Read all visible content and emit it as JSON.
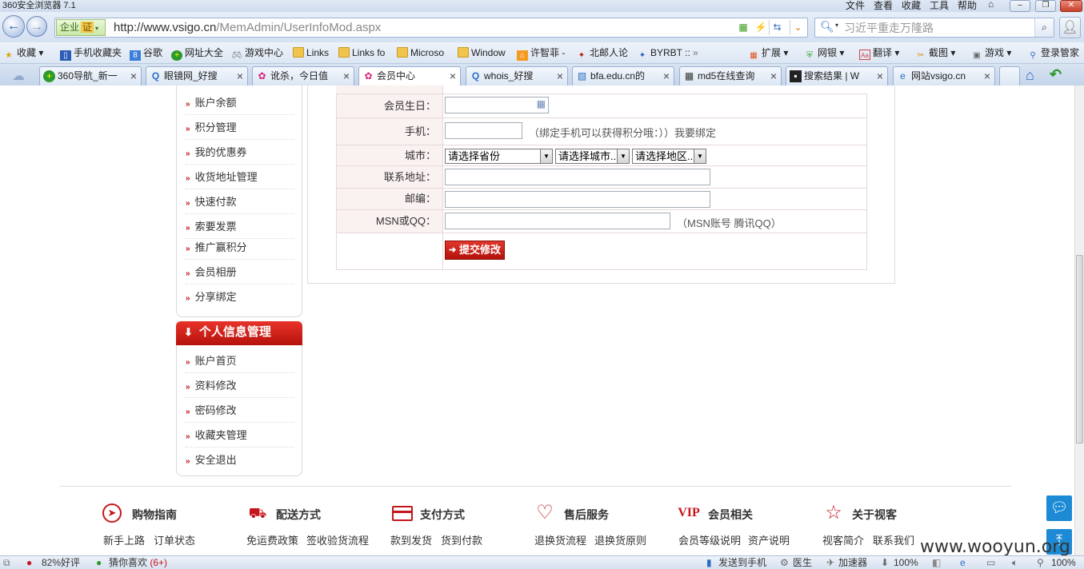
{
  "browser": {
    "title": "360安全浏览器 7.1",
    "menu": [
      "文件",
      "查看",
      "收藏",
      "工具",
      "帮助"
    ],
    "enterprise_label": "企业",
    "cert_label": "证",
    "url_host": "http://www.vsigo.cn",
    "url_path": "/MemAdmin/UserInfoMod.aspx",
    "search_placeholder": "习近平重走万隆路"
  },
  "bookmarks": [
    {
      "label": "收藏",
      "icon": "star-icon"
    },
    {
      "label": "手机收藏夹",
      "icon": "phone-icon"
    },
    {
      "label": "谷歌",
      "icon": "google-icon"
    },
    {
      "label": "网址大全",
      "icon": "360-icon"
    },
    {
      "label": "游戏中心",
      "icon": "gamepad-icon"
    },
    {
      "label": "Links",
      "icon": "folder-icon"
    },
    {
      "label": "Links fo",
      "icon": "folder-icon"
    },
    {
      "label": "Microso",
      "icon": "folder-icon"
    },
    {
      "label": "Window",
      "icon": "folder-icon"
    },
    {
      "label": "许智菲 -",
      "icon": "site-icon"
    },
    {
      "label": "北邮人论",
      "icon": "byr-icon"
    },
    {
      "label": "BYRBT ::",
      "icon": "byr-icon"
    },
    {
      "label": "»",
      "icon": ""
    }
  ],
  "toolbar_right": [
    {
      "label": "扩展",
      "icon": "grid-icon"
    },
    {
      "label": "网银",
      "icon": "shield-icon"
    },
    {
      "label": "翻译",
      "icon": "translate-icon"
    },
    {
      "label": "截图",
      "icon": "scissors-icon"
    },
    {
      "label": "游戏",
      "icon": "game-icon"
    },
    {
      "label": "登录管家",
      "icon": "login-icon"
    }
  ],
  "tabs": [
    {
      "label": "360导航_新一",
      "active": false
    },
    {
      "label": "眼镜网_好搜",
      "active": false
    },
    {
      "label": "讹杀，今日值",
      "active": false
    },
    {
      "label": "会员中心",
      "active": true
    },
    {
      "label": "whois_好搜",
      "active": false
    },
    {
      "label": "bfa.edu.cn的",
      "active": false
    },
    {
      "label": "md5在线查询",
      "active": false
    },
    {
      "label": "搜索结果 | W",
      "active": false
    },
    {
      "label": "网站vsigo.cn",
      "active": false
    }
  ],
  "sidebar": {
    "top_items": [
      "账户余额",
      "积分管理",
      "我的优惠券",
      "收货地址管理",
      "快速付款",
      "索要发票",
      "推广赢积分",
      "会员相册",
      "分享绑定"
    ],
    "section_title": "个人信息管理",
    "section_items": [
      "账户首页",
      "资料修改",
      "密码修改",
      "收藏夹管理",
      "安全退出"
    ]
  },
  "form": {
    "birthday_label": "会员生日：",
    "phone_label": "手机：",
    "phone_hint": "（绑定手机可以获得积分哦：））我要绑定",
    "city_label": "城市：",
    "province_select": "请选择省份",
    "city_select": "请选择城市..",
    "district_select": "请选择地区..",
    "address_label": "联系地址：",
    "zip_label": "邮编：",
    "msn_label": "MSN或QQ：",
    "msn_hint": "（MSN账号 腾讯QQ）",
    "submit_label": "提交修改"
  },
  "footer": {
    "columns": [
      {
        "title": "购物指南",
        "icon": "compass-icon",
        "links": [
          "新手上路",
          "订单状态"
        ]
      },
      {
        "title": "配送方式",
        "icon": "truck-icon",
        "links": [
          "免运费政策",
          "签收验货流程"
        ]
      },
      {
        "title": "支付方式",
        "icon": "card-icon",
        "links": [
          "款到发货",
          "货到付款"
        ]
      },
      {
        "title": "售后服务",
        "icon": "heart-icon",
        "links": [
          "退换货流程",
          "退换货原则"
        ]
      },
      {
        "title": "会员相关",
        "icon": "vip-icon",
        "links": [
          "会员等级说明",
          "资产说明"
        ]
      },
      {
        "title": "关于视客",
        "icon": "star-icon",
        "links": [
          "视客简介",
          "联系我们"
        ]
      }
    ],
    "vip_text": "VIP",
    "watermark": "www.wooyun.org"
  },
  "statusbar": {
    "rating": "82%好评",
    "guess": "猜你喜欢",
    "guess_count": "(6+)",
    "send_to_phone": "发送到手机",
    "doctor": "医生",
    "accelerator": "加速器",
    "download_pct": "100%",
    "zoom": "100%"
  }
}
